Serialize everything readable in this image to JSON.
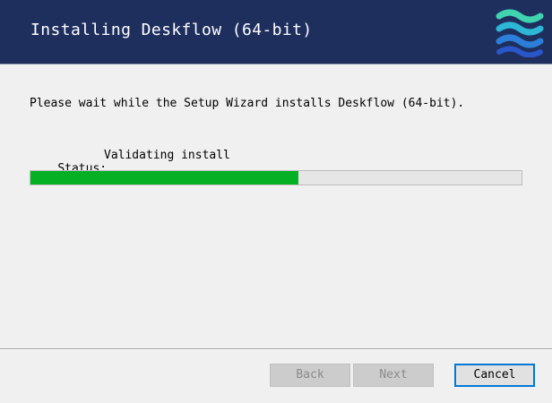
{
  "header": {
    "title": "Installing Deskflow (64-bit)",
    "logo_icon": "deskflow-waves-icon",
    "background_color": "#1e2f5e"
  },
  "main": {
    "intro_text": "Please wait while the Setup Wizard installs Deskflow (64-bit).",
    "status_label": "Status:",
    "status_value": "Validating install",
    "progress_fraction": 0.545,
    "progress_color": "#06b025"
  },
  "buttons": {
    "back_label": "Back",
    "next_label": "Next",
    "cancel_label": "Cancel",
    "back_enabled": false,
    "next_enabled": false,
    "cancel_enabled": true
  }
}
